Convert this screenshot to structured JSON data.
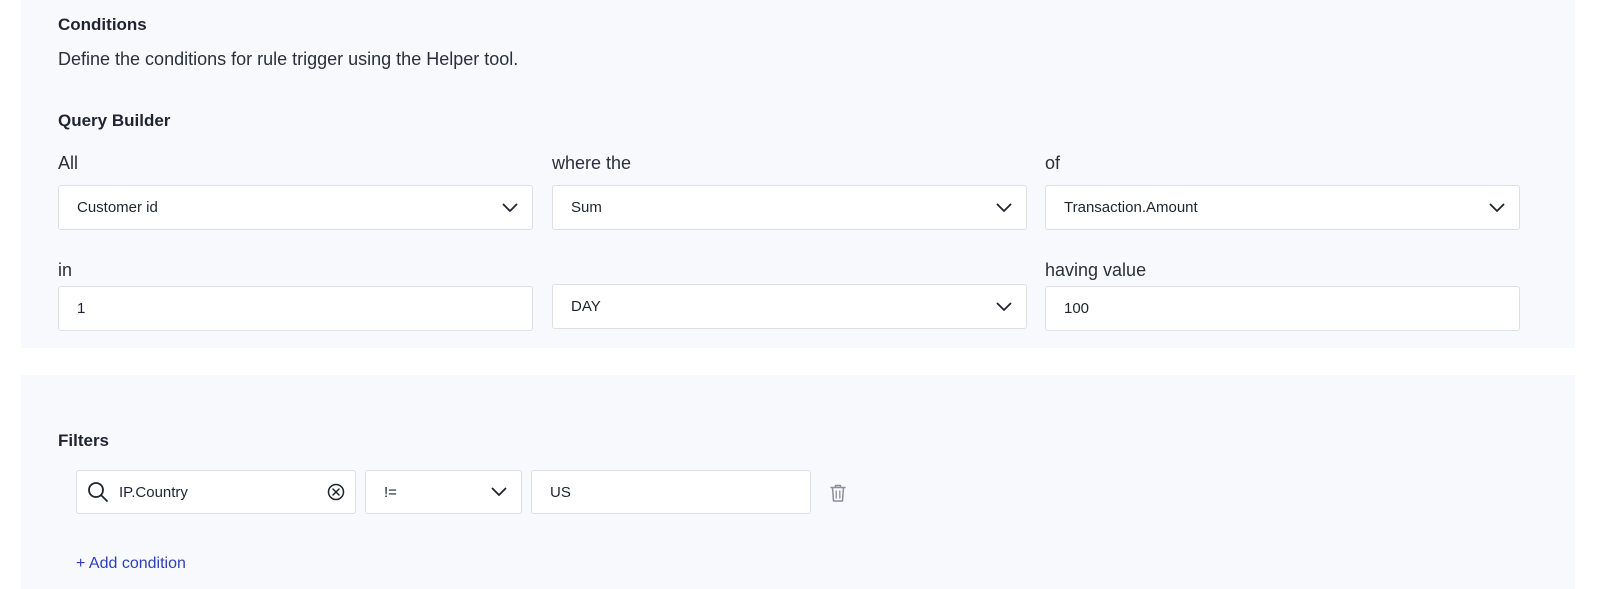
{
  "conditions": {
    "title": "Conditions",
    "description": "Define the conditions for rule trigger using the Helper tool."
  },
  "query_builder": {
    "title": "Query Builder",
    "row1": {
      "label_all": "All",
      "group_by_value": "Customer id",
      "label_where": "where the",
      "aggregate_value": "Sum",
      "label_of": "of",
      "field_value": "Transaction.Amount"
    },
    "row2": {
      "label_in": "in",
      "window_value": "1",
      "unit_value": "DAY",
      "label_having": "having value",
      "threshold_value": "100"
    }
  },
  "filters": {
    "title": "Filters",
    "items": [
      {
        "field": "IP.Country",
        "operator": "!=",
        "value": "US"
      }
    ],
    "add_condition_label": "+ Add condition"
  },
  "colors": {
    "panel_bg": "#f7f9fd",
    "link": "#2b3fbf",
    "border": "#dcdfe6"
  }
}
